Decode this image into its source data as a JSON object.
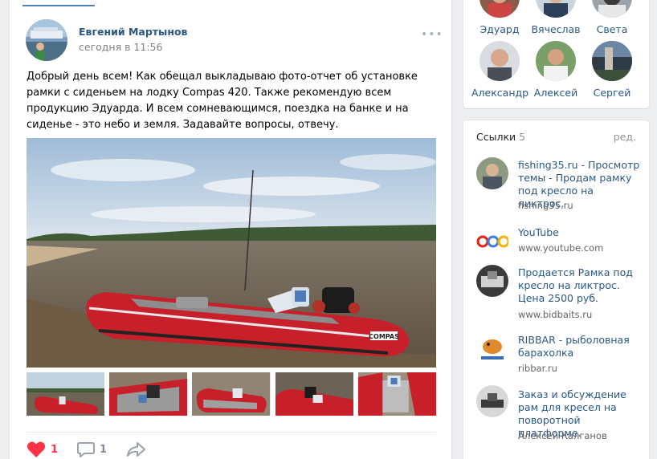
{
  "post": {
    "author": "Евгений Мартынов",
    "time": "сегодня в 11:56",
    "text": "Добрый день всем! Как обещал выкладываю фото-отчет об установке рамки с сиденьем на лодку Compas 420. Также рекомендую всем продукцию Эдуарда. И всем сомневающимся, поездка на банке и на сиденье - это небо и земля. Задавайте вопросы, отвечу.",
    "boat_label": "COMPAS",
    "likes": "1",
    "comments": "1"
  },
  "friends": [
    {
      "name": "Эдуард"
    },
    {
      "name": "Вячеслав"
    },
    {
      "name": "Света"
    },
    {
      "name": "Александр"
    },
    {
      "name": "Алексей"
    },
    {
      "name": "Сергей"
    }
  ],
  "links": {
    "header": "Ссылки",
    "count": "5",
    "edit": "ред.",
    "items": [
      {
        "title": "fishing35.ru - Просмотр темы - Продам рамку под кресло на ликтрос.",
        "sub": "fishing35.ru"
      },
      {
        "title": "YouTube",
        "sub": "www.youtube.com"
      },
      {
        "title": "Продается Рамка под кресло на ликтрос. Цена 2500 руб.",
        "sub": "www.bidbaits.ru"
      },
      {
        "title": "RIBBAR - рыболовная барахолка",
        "sub": "ribbar.ru"
      },
      {
        "title": "Заказ и обсуждение рам для кресел на поворотной платформе.",
        "sub": "Алексей Калганов"
      }
    ]
  },
  "colors": {
    "link": "#2a5885",
    "accent": "#5181b8",
    "like": "#ff3347",
    "boat": "#c8202a"
  }
}
